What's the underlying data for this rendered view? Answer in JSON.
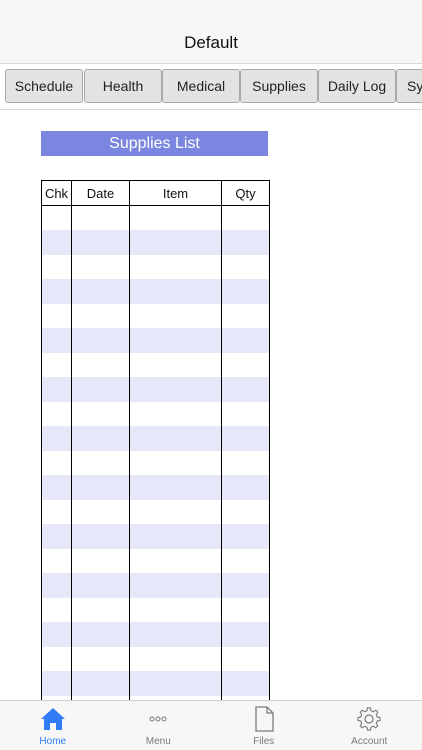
{
  "header": {
    "title": "Default"
  },
  "tabs": [
    {
      "label": "Schedule"
    },
    {
      "label": "Health"
    },
    {
      "label": "Medical"
    },
    {
      "label": "Supplies"
    },
    {
      "label": "Daily Log"
    },
    {
      "label": "Sy"
    }
  ],
  "supplies": {
    "title": "Supplies List",
    "columns": [
      "Chk",
      "Date",
      "Item",
      "Qty"
    ],
    "row_colors": {
      "alt": "#e6e8fa",
      "plain": "#ffffff"
    },
    "title_color": "#7b86e0"
  },
  "tab_bar": {
    "items": [
      {
        "label": "Home",
        "icon": "home-icon",
        "active": true
      },
      {
        "label": "Menu",
        "icon": "more-dots-icon",
        "active": false
      },
      {
        "label": "Files",
        "icon": "file-icon",
        "active": false
      },
      {
        "label": "Account",
        "icon": "gear-icon",
        "active": false
      }
    ],
    "active_color": "#2f7cf6",
    "inactive_color": "#7a7a7a"
  }
}
